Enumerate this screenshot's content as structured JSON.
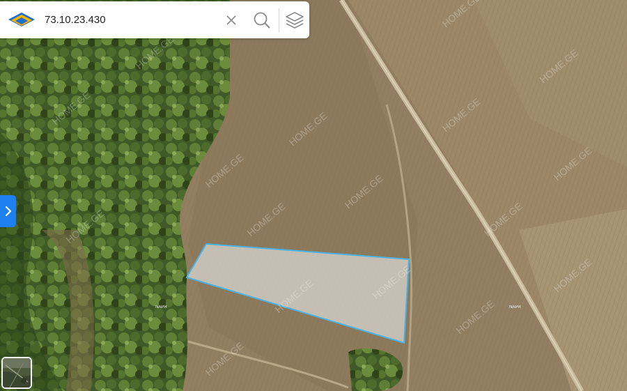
{
  "search": {
    "value": "73.10.23.430",
    "placeholder": "",
    "clear_icon": "close-icon",
    "search_icon": "search-icon",
    "layers_icon": "layers-icon"
  },
  "logo": {
    "icon": "house-logo-icon",
    "colors": [
      "#f7b500",
      "#1f6fd1"
    ]
  },
  "sidebar_toggle": {
    "icon": "chevron-right-icon",
    "color": "#1e7ff0"
  },
  "map": {
    "basemap": "satellite",
    "watermark_text": "HOME.GE",
    "place_labels": [
      "NAPR",
      "NAPR"
    ],
    "parcel": {
      "selected": true,
      "outline_color": "#4ab3e6",
      "fill": "rgba(235,235,235,0.6)"
    }
  },
  "basemap_switcher": {
    "icon": "satellite-thumbnail"
  }
}
